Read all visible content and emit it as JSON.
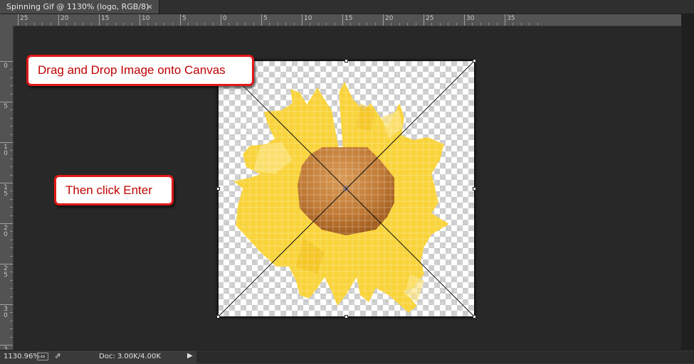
{
  "document_tab": {
    "title": "Spinning Gif @ 1130% (logo, RGB/8)",
    "close_glyph": "×"
  },
  "ruler_horizontal": {
    "labels": [
      "25",
      "20",
      "15",
      "10",
      "5",
      "0",
      "5",
      "10",
      "15",
      "20",
      "25",
      "30",
      "35"
    ]
  },
  "ruler_vertical": {
    "labels": [
      "0",
      "5",
      "10",
      "15",
      "20",
      "25",
      "30",
      "3"
    ]
  },
  "callouts": {
    "top": "Drag and Drop Image onto Canvas",
    "middle": "Then click Enter"
  },
  "status_bar": {
    "zoom": "1130.96%",
    "doc_size": "Doc: 3.00K/4.00K",
    "arrow": "▶"
  },
  "icons": {
    "document_close": "close-icon",
    "status_fit": "fit-screen-icon",
    "status_share": "share-icon",
    "status_menu": "play-arrow-icon"
  },
  "colors": {
    "callout_border": "#e21818",
    "callout_text": "#c00000",
    "petal": "#f9d33a",
    "center": "#b86a20"
  }
}
